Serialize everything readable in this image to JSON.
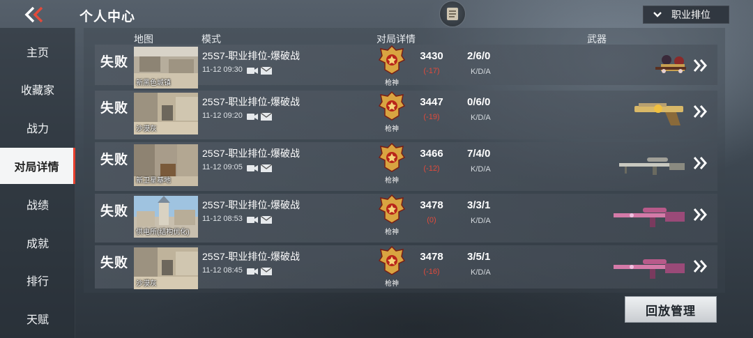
{
  "header": {
    "title": "个人中心",
    "filter_label": "职业排位"
  },
  "sidebar": {
    "items": [
      {
        "label": "主页"
      },
      {
        "label": "收藏家"
      },
      {
        "label": "战力"
      },
      {
        "label": "对局详情",
        "active": true
      },
      {
        "label": "战绩"
      },
      {
        "label": "成就"
      },
      {
        "label": "排行"
      },
      {
        "label": "天赋"
      }
    ]
  },
  "table": {
    "columns": {
      "map": "地图",
      "mode": "模式",
      "details": "对局详情",
      "weapon": "武器"
    },
    "kda_label": "K/D/A",
    "rows": [
      {
        "result": "失败",
        "map": "新黑色城镇",
        "mode": "25S7-职业排位-爆破战",
        "time": "11-12 09:30",
        "rank": "枪神",
        "score": "3430",
        "delta": "(-17)",
        "kda": "2/6/0",
        "weapon_icon": "dual-girls-weapon-icon",
        "map_style": "town"
      },
      {
        "result": "失败",
        "map": "沙漠灰",
        "mode": "25S7-职业排位-爆破战",
        "time": "11-12 09:20",
        "rank": "枪神",
        "score": "3447",
        "delta": "(-19)",
        "kda": "0/6/0",
        "weapon_icon": "golden-pistol-icon",
        "map_style": "desert"
      },
      {
        "result": "失败",
        "map": "新卫星基地",
        "mode": "25S7-职业排位-爆破战",
        "time": "11-12 09:05",
        "rank": "枪神",
        "score": "3466",
        "delta": "(-12)",
        "kda": "7/4/0",
        "weapon_icon": "sniper-rifle-icon",
        "map_style": "base"
      },
      {
        "result": "失败",
        "map": "供电所(结构优化)",
        "mode": "25S7-职业排位-爆破战",
        "time": "11-12 08:53",
        "rank": "枪神",
        "score": "3478",
        "delta": "(0)",
        "kda": "3/3/1",
        "weapon_icon": "pink-sniper-icon",
        "map_style": "sky"
      },
      {
        "result": "失败",
        "map": "沙漠灰",
        "mode": "25S7-职业排位-爆破战",
        "time": "11-12 08:45",
        "rank": "枪神",
        "score": "3478",
        "delta": "(-16)",
        "kda": "3/5/1",
        "weapon_icon": "pink-sniper-icon",
        "map_style": "desert"
      }
    ]
  },
  "replay_button": "回放管理",
  "colors": {
    "accent_red": "#e24a3b",
    "active_tab_bg": "#f4f5f6",
    "badge_gold": "#d9a441",
    "weapon_pink": "#d47aa8"
  }
}
